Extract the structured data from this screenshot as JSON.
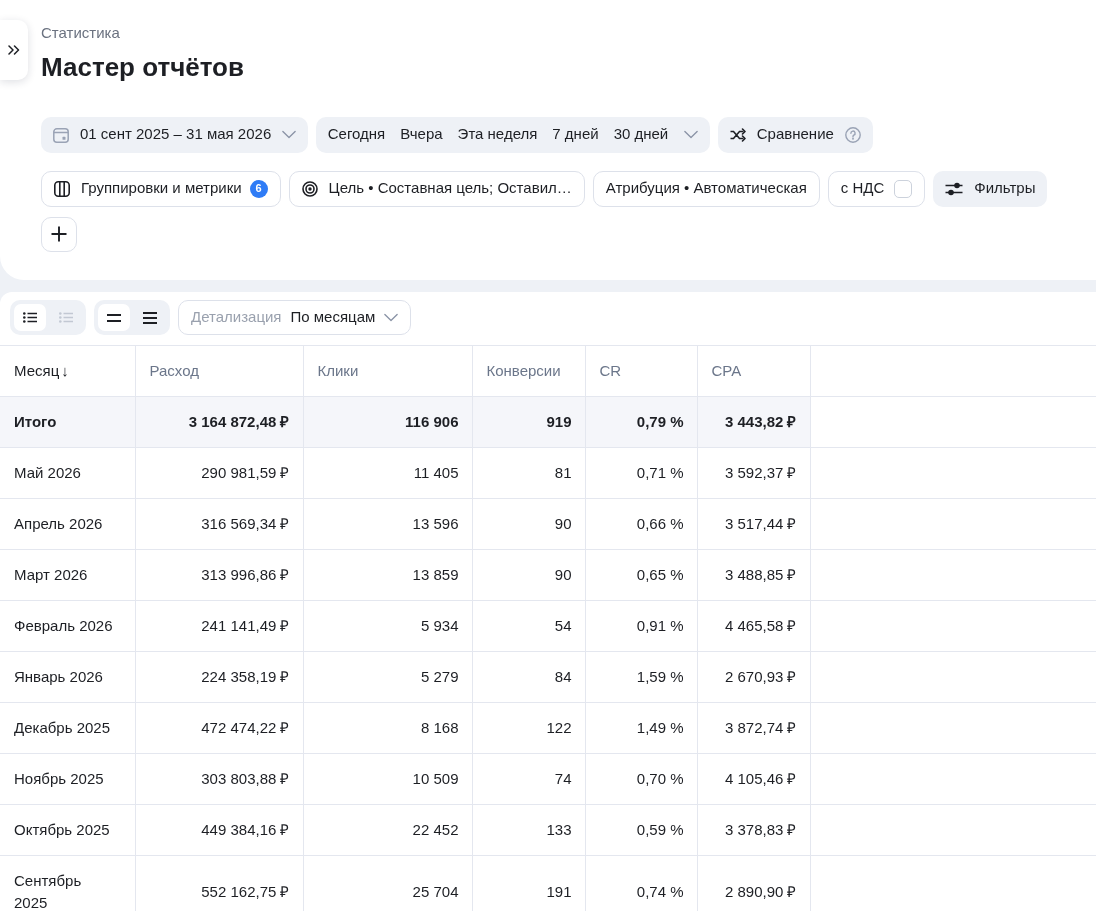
{
  "breadcrumb": "Статистика",
  "title": "Мастер отчётов",
  "period": {
    "date_range": "01 сент 2025 – 31 мая 2026",
    "presets": [
      "Сегодня",
      "Вчера",
      "Эта неделя",
      "7 дней",
      "30 дней"
    ],
    "comparison": "Сравнение"
  },
  "settings": [
    {
      "kind": "groupings",
      "label": "Группировки и метрики",
      "badge": "6"
    },
    {
      "kind": "goal",
      "label": "Цель • Составная цель; Оставил…"
    },
    {
      "kind": "attribution",
      "label": "Атрибуция • Автоматическая"
    },
    {
      "kind": "vat",
      "label": "с НДС",
      "checked": false
    },
    {
      "kind": "filters",
      "label": "Фильтры"
    }
  ],
  "table_toolbar": {
    "view_toggles": [
      {
        "kind": "list",
        "selected": true,
        "disabled": false
      },
      {
        "kind": "list",
        "selected": false,
        "disabled": true
      }
    ],
    "density_toggles": [
      {
        "kind": "two-lines",
        "selected": true,
        "disabled": false
      },
      {
        "kind": "three-lines",
        "selected": false,
        "disabled": false
      }
    ],
    "detail": {
      "label": "Детализация",
      "value": "По месяцам"
    }
  },
  "table": {
    "columns": [
      {
        "label": "Месяц",
        "sort_arrow": "↓",
        "sorted": true
      },
      {
        "label": "Расход",
        "sorted": false
      },
      {
        "label": "Клики",
        "sorted": false
      },
      {
        "label": "Конверсии",
        "sorted": false
      },
      {
        "label": "CR",
        "sorted": false
      },
      {
        "label": "CPA",
        "sorted": false
      }
    ],
    "total": [
      "Итого",
      "3 164 872,48 ₽",
      "116 906",
      "919",
      "0,79 %",
      "3 443,82 ₽"
    ],
    "rows": [
      [
        "Май 2026",
        "290 981,59 ₽",
        "11 405",
        "81",
        "0,71 %",
        "3 592,37 ₽"
      ],
      [
        "Апрель 2026",
        "316 569,34 ₽",
        "13 596",
        "90",
        "0,66 %",
        "3 517,44 ₽"
      ],
      [
        "Март 2026",
        "313 996,86 ₽",
        "13 859",
        "90",
        "0,65 %",
        "3 488,85 ₽"
      ],
      [
        "Февраль 2026",
        "241 141,49 ₽",
        "5 934",
        "54",
        "0,91 %",
        "4 465,58 ₽"
      ],
      [
        "Январь 2026",
        "224 358,19 ₽",
        "5 279",
        "84",
        "1,59 %",
        "2 670,93 ₽"
      ],
      [
        "Декабрь 2025",
        "472 474,22 ₽",
        "8 168",
        "122",
        "1,49 %",
        "3 872,74 ₽"
      ],
      [
        "Ноябрь 2025",
        "303 803,88 ₽",
        "10 509",
        "74",
        "0,70 %",
        "4 105,46 ₽"
      ],
      [
        "Октябрь 2025",
        "449 384,16 ₽",
        "22 452",
        "133",
        "0,59 %",
        "3 378,83 ₽"
      ],
      [
        "Сентябрь 2025",
        "552 162,75 ₽",
        "25 704",
        "191",
        "0,74 %",
        "2 890,90 ₽"
      ]
    ]
  }
}
